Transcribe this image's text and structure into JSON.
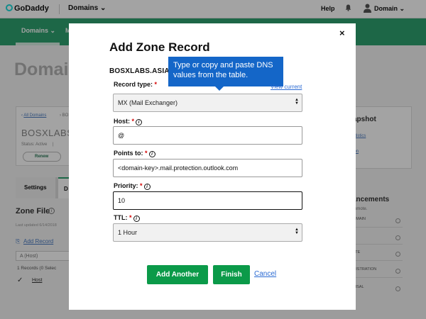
{
  "topbar": {
    "logo": "GoDaddy",
    "domains_menu": "Domains",
    "help": "Help",
    "user": "Domain"
  },
  "subnav": {
    "domains_tab": "Domains",
    "next_tab_fragment": "M"
  },
  "page": {
    "heading": "Domain",
    "breadcrumb_link": "All Domains",
    "breadcrumb_rest": "BOS",
    "domain_title": "BOSXLABS",
    "status": "Status: Active",
    "status_sep": "|",
    "renew_button": "Renew",
    "tabs": [
      "Settings",
      "D"
    ],
    "zone_file_title": "Zone File",
    "last_updated": "Last updated 6/14/2018",
    "add_record": "Add Record",
    "record_filter": "A (Host)",
    "records_count": "1 Records (0 Selec",
    "host_column": "Host"
  },
  "right_panel": {
    "snapshot_title": "apshot",
    "snapshot_link_1": "atistics",
    "snapshot_link_2": "ion",
    "enhancements_title": "ancements",
    "enhancements_sub": "romote.",
    "enhancement_rows": [
      "OMAIN",
      "D",
      "ATE",
      "GISTRATION",
      "AISAL"
    ]
  },
  "modal": {
    "title": "Add Zone Record",
    "close_label": "×",
    "domain": "BOSXLABS.ASIA",
    "tooltip": "Type or copy and paste DNS values from the table.",
    "view_current": "View current",
    "required_marker": "*",
    "record_type": {
      "label": "Record type:",
      "value": "MX (Mail Exchanger)"
    },
    "host": {
      "label": "Host:",
      "value": "@"
    },
    "points_to": {
      "label": "Points to:",
      "value": "<domain-key>.mail.protection.outlook.com"
    },
    "priority": {
      "label": "Priority:",
      "value": "10"
    },
    "ttl": {
      "label": "TTL:",
      "value": "1 Hour"
    },
    "buttons": {
      "add_another": "Add Another",
      "finish": "Finish",
      "cancel": "Cancel"
    }
  },
  "colors": {
    "brand_green": "#2ea26f",
    "button_green": "#0b9a49",
    "tooltip_blue": "#1466c8",
    "link_blue": "#2a6ad3",
    "required_red": "#d40000"
  }
}
